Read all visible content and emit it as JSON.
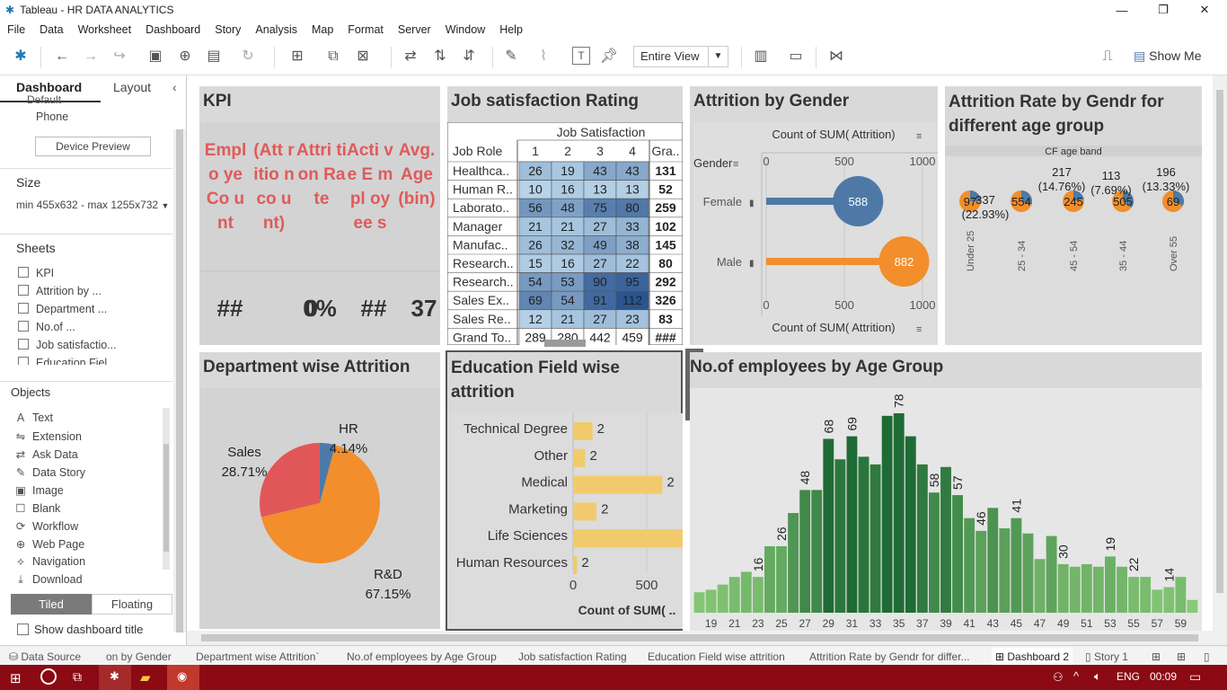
{
  "window": {
    "title": "Tableau - HR DATA ANALYTICS"
  },
  "menu": [
    "File",
    "Data",
    "Worksheet",
    "Dashboard",
    "Story",
    "Analysis",
    "Map",
    "Format",
    "Server",
    "Window",
    "Help"
  ],
  "toolbar": {
    "fit": "Entire View",
    "show_me": "Show Me"
  },
  "left_panel": {
    "tabs": [
      "Dashboard",
      "Layout"
    ],
    "device_default": "Default",
    "device_phone": "Phone",
    "device_preview": "Device Preview",
    "size_label": "Size",
    "size_value": "min 455x632 - max 1255x732",
    "sheets_label": "Sheets",
    "sheets": [
      "KPI",
      "Attrition by ...",
      "Department ...",
      "No.of ...",
      "Job satisfactio...",
      "Education Fiel..."
    ],
    "objects_label": "Objects",
    "objects": [
      "Text",
      "Extension",
      "Ask Data",
      "Data Story",
      "Image",
      "Blank",
      "Workflow",
      "Web Page",
      "Navigation",
      "Download"
    ],
    "tiled": "Tiled",
    "floating": "Floating",
    "show_title": "Show dashboard title"
  },
  "kpi": {
    "title": "KPI",
    "headers": [
      "Emplo ye Co unt",
      "(Att ritio n co unt)",
      "Attri tion Rate",
      "Acti ve E mpl oyee s",
      "Avg. Age (bin)"
    ],
    "values": [
      "##",
      "0",
      "0%",
      "##",
      "37"
    ]
  },
  "job_sat": {
    "title": "Job satisfaction Rating",
    "col_group": "Job Satisfaction",
    "row_header": "Job Role",
    "columns": [
      "1",
      "2",
      "3",
      "4",
      "Gra.."
    ],
    "rows": [
      {
        "role": "Healthca..",
        "vals": [
          "26",
          "19",
          "43",
          "43"
        ],
        "total": "131"
      },
      {
        "role": "Human R..",
        "vals": [
          "10",
          "16",
          "13",
          "13"
        ],
        "total": "52"
      },
      {
        "role": "Laborato..",
        "vals": [
          "56",
          "48",
          "75",
          "80"
        ],
        "total": "259"
      },
      {
        "role": "Manager",
        "vals": [
          "21",
          "21",
          "27",
          "33"
        ],
        "total": "102"
      },
      {
        "role": "Manufac..",
        "vals": [
          "26",
          "32",
          "49",
          "38"
        ],
        "total": "145"
      },
      {
        "role": "Research..",
        "vals": [
          "15",
          "16",
          "27",
          "22"
        ],
        "total": "80"
      },
      {
        "role": "Research..",
        "vals": [
          "54",
          "53",
          "90",
          "95"
        ],
        "total": "292"
      },
      {
        "role": "Sales Ex..",
        "vals": [
          "69",
          "54",
          "91",
          "112"
        ],
        "total": "326"
      },
      {
        "role": "Sales Re..",
        "vals": [
          "12",
          "21",
          "27",
          "23"
        ],
        "total": "83"
      }
    ],
    "grand": {
      "role": "Grand To..",
      "vals": [
        "289",
        "280",
        "442",
        "459"
      ],
      "total": "###"
    }
  },
  "gender": {
    "title": "Attrition by Gender",
    "axis_title": "Count of SUM( Attrition)",
    "row_header": "Gender",
    "ticks": [
      "0",
      "500",
      "1000"
    ],
    "colors": {
      "Female": "#4e79a7",
      "Male": "#f28e2b"
    }
  },
  "agegender": {
    "title": "Attrition Rate by Gendr for different age group",
    "header": "CF age band",
    "bands": [
      "Under 25",
      "25 - 34",
      "45 - 54",
      "35 - 44",
      "Over 55"
    ],
    "counts": [
      "97",
      "554",
      "245",
      "505",
      "69"
    ],
    "labels_top": [
      "337",
      "217",
      "113",
      "196"
    ],
    "labels_pct": [
      "(22.93%)",
      "(14.76%)",
      "(7.69%)",
      "(13.33%)"
    ]
  },
  "dept": {
    "title": "Department wise Attrition",
    "slices": [
      {
        "name": "HR",
        "pct": "4.14%",
        "color": "#4e79a7"
      },
      {
        "name": "Sales",
        "pct": "28.71%",
        "color": "#e15759"
      },
      {
        "name": "R&D",
        "pct": "67.15%",
        "color": "#f28e2b"
      }
    ]
  },
  "edu": {
    "title": "Education Field wise attrition",
    "axis_title": "Count of SUM( ..",
    "ticks": [
      "0",
      "500"
    ],
    "fields": [
      "Technical Degree",
      "Other",
      "Medical",
      "Marketing",
      "Life Sciences",
      "Human Resources"
    ],
    "labels": [
      "2",
      "2",
      "2",
      "2",
      "2",
      "2"
    ]
  },
  "age": {
    "title": "No.of employees by Age Group",
    "xticks": [
      "19",
      "21",
      "23",
      "25",
      "27",
      "29",
      "31",
      "33",
      "35",
      "37",
      "39",
      "41",
      "43",
      "45",
      "47",
      "49",
      "51",
      "53",
      "55",
      "57",
      "59"
    ]
  },
  "chart_data": [
    {
      "type": "bar",
      "title": "Attrition by Gender",
      "categories": [
        "Female",
        "Male"
      ],
      "values": [
        588,
        882
      ],
      "xlim": [
        0,
        1000
      ]
    },
    {
      "type": "pie",
      "title": "Department wise Attrition",
      "categories": [
        "HR",
        "Sales",
        "R&D"
      ],
      "values": [
        4.14,
        28.71,
        67.15
      ]
    },
    {
      "type": "bar",
      "title": "Education Field wise attrition",
      "categories": [
        "Technical Degree",
        "Other",
        "Medical",
        "Marketing",
        "Life Sciences",
        "Human Resources"
      ],
      "values": [
        132,
        82,
        606,
        159,
        786,
        27
      ],
      "xlim": [
        0,
        750
      ]
    },
    {
      "type": "bar",
      "title": "No.of employees by Age Group",
      "categories": [
        "18",
        "19",
        "20",
        "21",
        "22",
        "23",
        "24",
        "25",
        "26",
        "27",
        "28",
        "29",
        "30",
        "31",
        "32",
        "33",
        "34",
        "35",
        "36",
        "37",
        "38",
        "39",
        "40",
        "41",
        "42",
        "43",
        "44",
        "45",
        "46",
        "47",
        "48",
        "49",
        "50",
        "51",
        "52",
        "53",
        "54",
        "55",
        "56",
        "57",
        "58",
        "59",
        "60"
      ],
      "values": [
        8,
        9,
        11,
        14,
        16,
        14,
        26,
        26,
        39,
        48,
        48,
        68,
        60,
        69,
        61,
        58,
        77,
        78,
        69,
        58,
        47,
        57,
        46,
        37,
        32,
        41,
        33,
        37,
        31,
        21,
        30,
        19,
        18,
        19,
        18,
        22,
        18,
        14,
        14,
        9,
        10,
        14,
        5
      ],
      "labels": {
        "23": "16",
        "25": "26",
        "27": "48",
        "29": "68",
        "31": "69",
        "35": "78",
        "38": "58",
        "40": "57",
        "42": "46",
        "45": "41",
        "49": "30",
        "53": "19",
        "55": "22",
        "58": "14"
      }
    }
  ]
}
